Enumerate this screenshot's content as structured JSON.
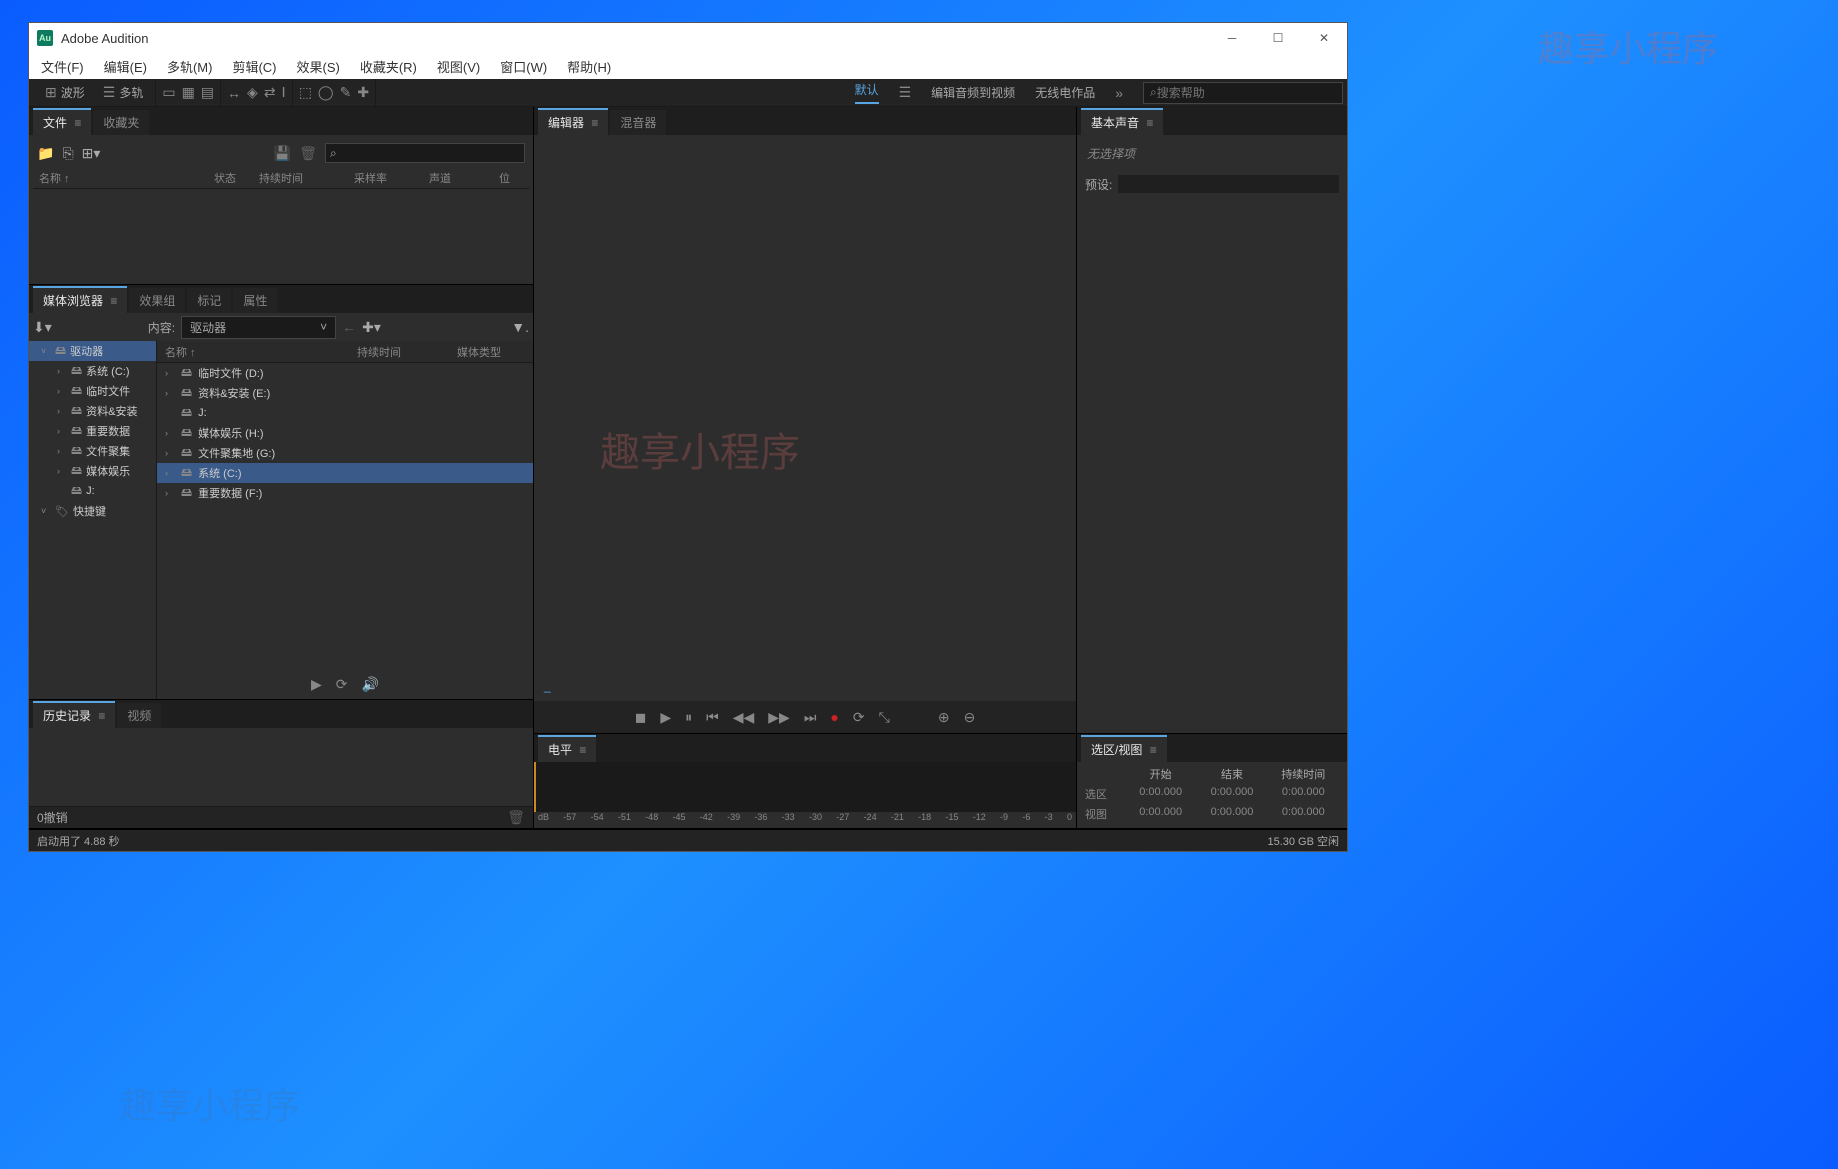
{
  "watermark": "趣享小程序",
  "app_title": "Adobe Audition",
  "app_icon_text": "Au",
  "menubar": [
    "文件(F)",
    "编辑(E)",
    "多轨(M)",
    "剪辑(C)",
    "效果(S)",
    "收藏夹(R)",
    "视图(V)",
    "窗口(W)",
    "帮助(H)"
  ],
  "toolbar": {
    "waveform": "波形",
    "multitrack": "多轨"
  },
  "workspaces": {
    "default": "默认",
    "edit_audio": "编辑音频到视频",
    "radio": "无线电作品"
  },
  "search_placeholder": "搜索帮助",
  "panels": {
    "files": {
      "tab_files": "文件",
      "tab_favorites": "收藏夹",
      "headers": {
        "name": "名称",
        "status": "状态",
        "duration": "持续时间",
        "sample_rate": "采样率",
        "channels": "声道",
        "bits": "位"
      }
    },
    "media_browser": {
      "tab_browser": "媒体浏览器",
      "tab_effects": "效果组",
      "tab_markers": "标记",
      "tab_properties": "属性",
      "content_label": "内容:",
      "dropdown": "驱动器",
      "headers": {
        "name": "名称",
        "duration": "持续时间",
        "type": "媒体类型"
      },
      "tree": [
        {
          "label": "驱动器",
          "selected": true,
          "expanded": true
        },
        {
          "label": "系统 (C:)",
          "child": true
        },
        {
          "label": "临时文件",
          "child": true
        },
        {
          "label": "资料&安装",
          "child": true
        },
        {
          "label": "重要数据",
          "child": true
        },
        {
          "label": "文件聚集",
          "child": true
        },
        {
          "label": "媒体娱乐",
          "child": true
        },
        {
          "label": "J:",
          "child": true
        },
        {
          "label": "快捷键",
          "expanded": true
        }
      ],
      "list": [
        {
          "label": "临时文件 (D:)"
        },
        {
          "label": "资料&安装 (E:)"
        },
        {
          "label": "J:"
        },
        {
          "label": "媒体娱乐 (H:)"
        },
        {
          "label": "文件聚集地 (G:)"
        },
        {
          "label": "系统 (C:)",
          "selected": true
        },
        {
          "label": "重要数据 (F:)"
        }
      ]
    },
    "history": {
      "tab_history": "历史记录",
      "tab_video": "视频",
      "undo_text": "0撤销"
    },
    "editor": {
      "tab_editor": "编辑器",
      "tab_mixer": "混音器",
      "timecode": "_"
    },
    "levels": {
      "tab": "电平",
      "scale": [
        "dB",
        "-57",
        "-54",
        "-51",
        "-48",
        "-45",
        "-42",
        "-39",
        "-36",
        "-33",
        "-30",
        "-27",
        "-24",
        "-21",
        "-18",
        "-15",
        "-12",
        "-9",
        "-6",
        "-3",
        "0"
      ]
    },
    "essential": {
      "tab": "基本声音",
      "no_selection": "无选择项",
      "preset_label": "预设:"
    },
    "selection": {
      "tab": "选区/视图",
      "headers": {
        "start": "开始",
        "end": "结束",
        "duration": "持续时间"
      },
      "rows": {
        "selection": {
          "label": "选区",
          "start": "0:00.000",
          "end": "0:00.000",
          "duration": "0:00.000"
        },
        "view": {
          "label": "视图",
          "start": "0:00.000",
          "end": "0:00.000",
          "duration": "0:00.000"
        }
      }
    }
  },
  "status_bar": {
    "startup": "启动用了 4.88 秒",
    "disk": "15.30 GB 空闲"
  }
}
